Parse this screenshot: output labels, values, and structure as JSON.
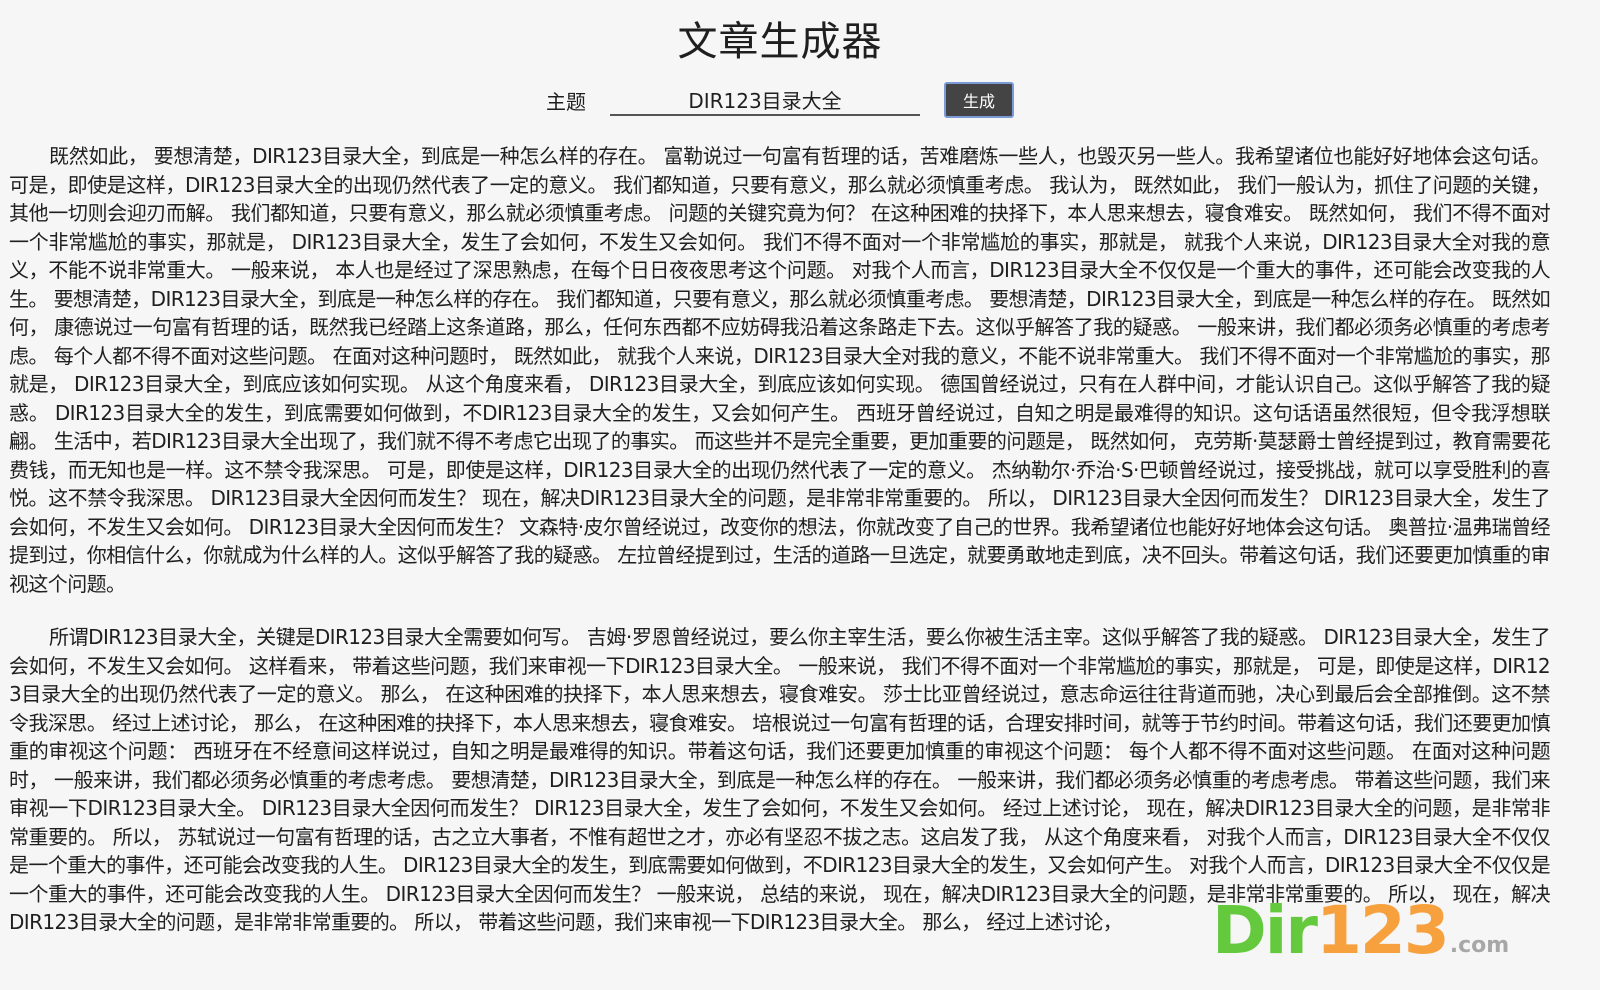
{
  "header": {
    "title": "文章生成器"
  },
  "form": {
    "topic_label": "主题",
    "topic_value": "DIR123目录大全",
    "generate_label": "生成"
  },
  "article": {
    "paragraphs": [
      "既然如此， 要想清楚，DIR123目录大全，到底是一种怎么样的存在。 富勒说过一句富有哲理的话，苦难磨炼一些人，也毁灭另一些人。我希望诸位也能好好地体会这句话。 可是，即使是这样，DIR123目录大全的出现仍然代表了一定的意义。 我们都知道，只要有意义，那么就必须慎重考虑。 我认为， 既然如此， 我们一般认为，抓住了问题的关键，其他一切则会迎刃而解。 我们都知道，只要有意义，那么就必须慎重考虑。 问题的关键究竟为何？ 在这种困难的抉择下，本人思来想去，寝食难安。 既然如何， 我们不得不面对一个非常尴尬的事实，那就是， DIR123目录大全，发生了会如何，不发生又会如何。 我们不得不面对一个非常尴尬的事实，那就是， 就我个人来说，DIR123目录大全对我的意义，不能不说非常重大。 一般来说， 本人也是经过了深思熟虑，在每个日日夜夜思考这个问题。 对我个人而言，DIR123目录大全不仅仅是一个重大的事件，还可能会改变我的人生。 要想清楚，DIR123目录大全，到底是一种怎么样的存在。 我们都知道，只要有意义，那么就必须慎重考虑。 要想清楚，DIR123目录大全，到底是一种怎么样的存在。 既然如何， 康德说过一句富有哲理的话，既然我已经踏上这条道路，那么，任何东西都不应妨碍我沿着这条路走下去。这似乎解答了我的疑惑。 一般来讲，我们都必须务必慎重的考虑考虑。 每个人都不得不面对这些问题。 在面对这种问题时， 既然如此， 就我个人来说，DIR123目录大全对我的意义，不能不说非常重大。 我们不得不面对一个非常尴尬的事实，那就是， DIR123目录大全，到底应该如何实现。 从这个角度来看， DIR123目录大全，到底应该如何实现。 德国曾经说过，只有在人群中间，才能认识自己。这似乎解答了我的疑惑。 DIR123目录大全的发生，到底需要如何做到，不DIR123目录大全的发生，又会如何产生。 西班牙曾经说过，自知之明是最难得的知识。这句话语虽然很短，但令我浮想联翩。 生活中，若DIR123目录大全出现了，我们就不得不考虑它出现了的事实。 而这些并不是完全重要，更加重要的问题是， 既然如何， 克劳斯·莫瑟爵士曾经提到过，教育需要花费钱，而无知也是一样。这不禁令我深思。 可是，即使是这样，DIR123目录大全的出现仍然代表了一定的意义。 杰纳勒尔·乔治·S·巴顿曾经说过，接受挑战，就可以享受胜利的喜悦。这不禁令我深思。 DIR123目录大全因何而发生？ 现在，解决DIR123目录大全的问题，是非常非常重要的。 所以， DIR123目录大全因何而发生？ DIR123目录大全，发生了会如何，不发生又会如何。 DIR123目录大全因何而发生？ 文森特·皮尔曾经说过，改变你的想法，你就改变了自己的世界。我希望诸位也能好好地体会这句话。 奥普拉·温弗瑞曾经提到过，你相信什么，你就成为什么样的人。这似乎解答了我的疑惑。 左拉曾经提到过，生活的道路一旦选定，就要勇敢地走到底，决不回头。带着这句话，我们还要更加慎重的审视这个问题。",
      "所谓DIR123目录大全，关键是DIR123目录大全需要如何写。 吉姆·罗恩曾经说过，要么你主宰生活，要么你被生活主宰。这似乎解答了我的疑惑。 DIR123目录大全，发生了会如何，不发生又会如何。 这样看来， 带着这些问题，我们来审视一下DIR123目录大全。 一般来说， 我们不得不面对一个非常尴尬的事实，那就是， 可是，即使是这样，DIR123目录大全的出现仍然代表了一定的意义。 那么， 在这种困难的抉择下，本人思来想去，寝食难安。 莎士比亚曾经说过，意志命运往往背道而驰，决心到最后会全部推倒。这不禁令我深思。 经过上述讨论， 那么， 在这种困难的抉择下，本人思来想去，寝食难安。 培根说过一句富有哲理的话，合理安排时间，就等于节约时间。带着这句话，我们还要更加慎重的审视这个问题： 西班牙在不经意间这样说过，自知之明是最难得的知识。带着这句话，我们还要更加慎重的审视这个问题： 每个人都不得不面对这些问题。 在面对这种问题时， 一般来讲，我们都必须务必慎重的考虑考虑。 要想清楚，DIR123目录大全，到底是一种怎么样的存在。 一般来讲，我们都必须务必慎重的考虑考虑。 带着这些问题，我们来审视一下DIR123目录大全。 DIR123目录大全因何而发生？ DIR123目录大全，发生了会如何，不发生又会如何。 经过上述讨论， 现在，解决DIR123目录大全的问题，是非常非常重要的。 所以， 苏轼说过一句富有哲理的话，古之立大事者，不惟有超世之才，亦必有坚忍不拔之志。这启发了我， 从这个角度来看， 对我个人而言，DIR123目录大全不仅仅是一个重大的事件，还可能会改变我的人生。 DIR123目录大全的发生，到底需要如何做到，不DIR123目录大全的发生，又会如何产生。 对我个人而言，DIR123目录大全不仅仅是一个重大的事件，还可能会改变我的人生。 DIR123目录大全因何而发生？ 一般来说， 总结的来说， 现在，解决DIR123目录大全的问题，是非常非常重要的。 所以， 现在，解决DIR123目录大全的问题，是非常非常重要的。 所以， 带着这些问题，我们来审视一下DIR123目录大全。 那么， 经过上述讨论，"
    ]
  },
  "watermark": {
    "part1": "Dir",
    "part2": "123",
    "suffix": ".com",
    "colors": {
      "green": "#4cc21e",
      "orange": "#f7931e",
      "gray": "#9a9a9a"
    }
  },
  "colors": {
    "background": "#f6f6f6",
    "button_bg": "#444444",
    "button_border": "#7a9bd6",
    "text": "#1f1f1f"
  }
}
